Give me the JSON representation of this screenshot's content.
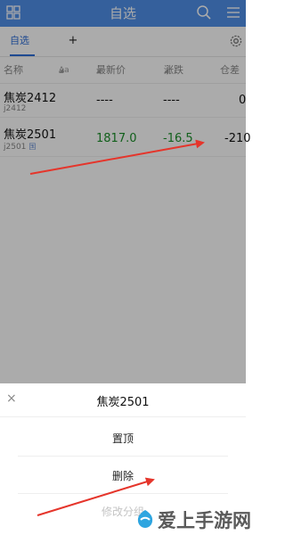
{
  "header": {
    "title": "自选",
    "search_icon": "search-icon",
    "menu_icon": "menu-icon",
    "grid_icon": "grid-icon",
    "bar_color": "#4f8fe9"
  },
  "tabs": {
    "active": "自选",
    "add": "+",
    "settings_icon": "gear-icon"
  },
  "columns": {
    "name": "名称",
    "sort": "Aa",
    "price": "最新价",
    "change": "涨跌",
    "open_interest": "仓差"
  },
  "rows": [
    {
      "name": "焦炭2412",
      "code": "j2412",
      "price": "----",
      "change": "----",
      "open_interest": "0",
      "market_tag": ""
    },
    {
      "name": "焦炭2501",
      "code": "j2501",
      "price": "1817.0",
      "change": "-16.5",
      "open_interest": "-210",
      "market_tag": "国"
    }
  ],
  "sheet": {
    "title": "焦炭2501",
    "close": "×",
    "options": [
      "置顶",
      "删除",
      "修改分组"
    ]
  },
  "colors": {
    "accent": "#2f6fd8",
    "positive_value": "#1b8f2a",
    "arrow": "#e5352b"
  },
  "watermark": {
    "text": "爱上手游网"
  }
}
